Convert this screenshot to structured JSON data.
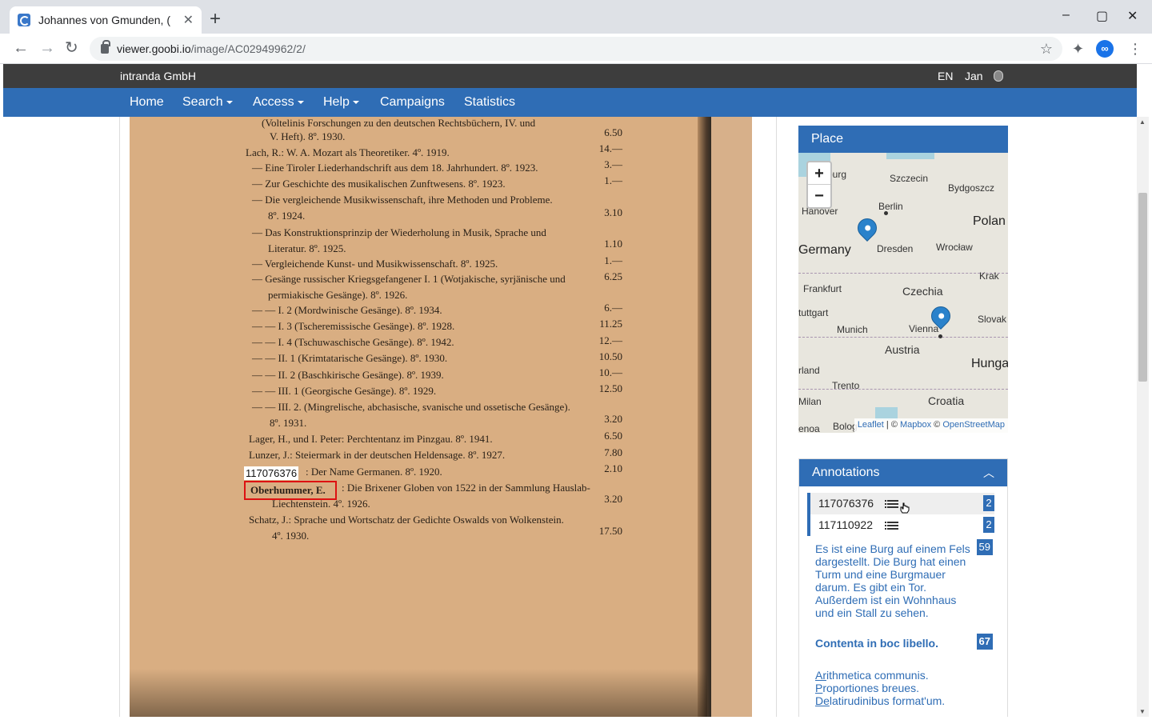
{
  "browser": {
    "tab_title": "Johannes von Gmunden, (",
    "url_host": "viewer.goobi.io",
    "url_path": "/image/AC02949962/2/"
  },
  "site": {
    "org": "intranda GmbH",
    "lang": "EN",
    "user": "Jan"
  },
  "nav": {
    "home": "Home",
    "search": "Search",
    "access": "Access",
    "help": "Help",
    "campaigns": "Campaigns",
    "statistics": "Statistics"
  },
  "scan": {
    "lines": [
      "(Voltelinis Forschungen zu den deutschen Rechtsbüchern, IV. und",
      "V. Heft). 8º. 1930.",
      "Lach, R.: W. A. Mozart als Theoretiker. 4º. 1919.",
      "— Eine Tiroler Liederhandschrift aus dem 18. Jahrhundert. 8º. 1923.",
      "— Zur Geschichte des musikalischen Zunftwesens. 8º. 1923.",
      "— Die vergleichende Musikwissenschaft, ihre Methoden und Probleme.",
      "8º. 1924.",
      "— Das Konstruktionsprinzip der Wiederholung in Musik, Sprache und",
      "Literatur. 8º. 1925.",
      "— Vergleichende Kunst- und Musikwissenschaft. 8º. 1925.",
      "— Gesänge russischer Kriegsgefangener I. 1 (Wotjakische, syrjänische und",
      "permiakische Gesänge). 8º. 1926.",
      "— — I. 2 (Mordwinische Gesänge). 8º. 1934.",
      "— — I. 3 (Tscheremissische Gesänge). 8º. 1928.",
      "— — I. 4 (Tschuwaschische Gesänge). 8º. 1942.",
      "— — II. 1 (Krimtatarische Gesänge). 8º. 1930.",
      "— — II. 2 (Baschkirische Gesänge). 8º. 1939.",
      "— — III. 1 (Georgische Gesänge). 8º. 1929.",
      "— — III. 2. (Mingrelische, abchasische, svanische und ossetische Gesänge).",
      "8º. 1931.",
      "Lager, H., und I. Peter: Perchtentanz im Pinzgau. 8º. 1941.",
      "Lunzer, J.: Steiermark in der deutschen Heldensage. 8º. 1927.",
      ": Der Name Germanen. 8º. 1920.",
      ": Die Brixener Globen von 1522 in der Sammlung Hauslab-",
      "Liechtenstein. 4º. 1926.",
      "Schatz, J.: Sprache und Wortschatz der Gedichte Oswalds von Wolkenstein.",
      "4º. 1930."
    ],
    "prices": [
      "6.50",
      "14.—",
      "3.—",
      "1.—",
      "3.10",
      "1.10",
      "1.—",
      "6.25",
      "6.—",
      "11.25",
      "12.—",
      "10.50",
      "10.—",
      "12.50",
      "3.20",
      "6.50",
      "7.80",
      "2.10",
      "3.20",
      "17.50"
    ],
    "highlight_id": "117076376",
    "highlight_name": "Oberhummer, E."
  },
  "place": {
    "title": "Place",
    "zoom_in": "+",
    "zoom_out": "−",
    "labels": {
      "hamburg": "burg",
      "szczecin": "Szczecin",
      "bydgoszcz": "Bydgoszcz",
      "berlin": "Berlin",
      "hanover": "Hanover",
      "poland": "Polan",
      "germany": "Germany",
      "dresden": "Dresden",
      "wroclaw": "Wrocław",
      "krakow": "Krak",
      "frankfurt": "Frankfurt",
      "czechia": "Czechia",
      "stuttgart": "tuttgart",
      "munich": "Munich",
      "vienna": "Vienna",
      "slovakia": "Slovak",
      "austria": "Austria",
      "switzerland": "rland",
      "hungary": "Hunga",
      "trento": "Trento",
      "croatia": "Croatia",
      "milan": "Milan",
      "genoa": "enoa",
      "bologna": "Bolog"
    },
    "attribution": {
      "leaflet": "Leaflet",
      "sep1": " | © ",
      "mapbox": "Mapbox",
      "sep2": " © ",
      "osm": "OpenStreetMap"
    }
  },
  "annotations": {
    "title": "Annotations",
    "items": [
      {
        "id": "117076376",
        "count": "2"
      },
      {
        "id": "117110922",
        "count": "2"
      }
    ],
    "text1": "Es ist eine Burg auf einem Fels dargestellt. Die Burg hat einen Turm und eine Burgmauer darum. Es gibt ein Tor. Außerdem ist ein Wohnhaus und ein Stall zu sehen.",
    "text1_count": "59",
    "text2": "Contenta in boc libello.",
    "text2_count": "67",
    "text3_lines": [
      {
        "u": "Ar",
        "rest": "ithmetica communis."
      },
      {
        "u": "P",
        "rest": "roportiones breues."
      },
      {
        "u": "De",
        "rest": "latirudinibus format'um."
      }
    ]
  },
  "colors": {
    "brand_blue": "#2f6db5",
    "top_bar": "#3d3d3d"
  }
}
